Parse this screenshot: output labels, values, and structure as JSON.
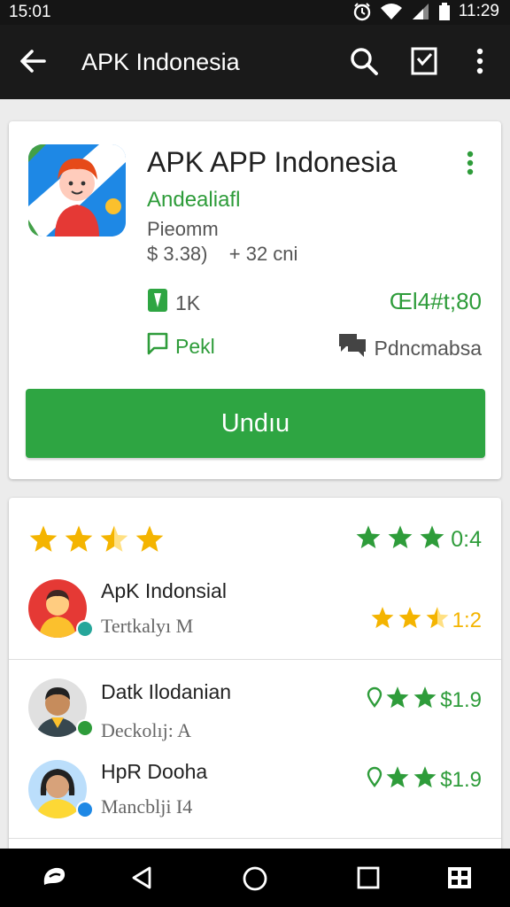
{
  "status_bar": {
    "time_left": "15:01",
    "time_right": "11:29",
    "icons": [
      "alarm-icon",
      "wifi-icon",
      "signal-icon",
      "battery-icon"
    ]
  },
  "app_bar": {
    "title": "APK Indonesia",
    "icons": [
      "back-arrow-icon",
      "search-icon",
      "inbox-check-icon",
      "more-vert-icon"
    ]
  },
  "app_card": {
    "name": "APK APP Indonesia",
    "developer": "Andealiafl",
    "category": "Pieomm",
    "price_line": "$ 3.38)",
    "size_line": "+ 32 cni",
    "downloads": "1K",
    "downloads_right": "Œl4#t;80",
    "rating_label": "Pekl",
    "reviews_label": "Pdncmabsa",
    "install_label": "Undıu",
    "accent_color": "#2ea542"
  },
  "reviews_card": {
    "summary_left_stars": 3.5,
    "summary_right_stars": 3,
    "summary_right_value": "0:4",
    "reviews": [
      {
        "name": "ApK Indonsial",
        "subtitle": "Tertkalyı M",
        "stars": 2.5,
        "value": "1:2",
        "color": "#f4b400"
      },
      {
        "name": "Datk Ilodanian",
        "subtitle": "Deckolıj: A",
        "stars": 2,
        "value": "$1.9",
        "color": "#2e9c3a"
      },
      {
        "name": "HpR Dooha",
        "subtitle": "Mancblji I4",
        "stars": 2,
        "value": "$1.9",
        "color": "#2e9c3a"
      }
    ]
  },
  "nav_bar": {
    "icons": [
      "assistant-icon",
      "back-triangle-icon",
      "home-circle-icon",
      "recents-square-icon",
      "grid-icon"
    ]
  }
}
